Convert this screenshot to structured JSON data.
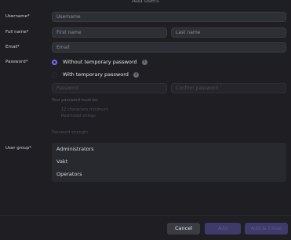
{
  "dialog": {
    "title": "Add users"
  },
  "form": {
    "username_label": "Username*",
    "username_placeholder": "Username",
    "fullname_label": "Full name*",
    "firstname_placeholder": "First name",
    "lastname_placeholder": "Last name",
    "email_label": "Email*",
    "email_placeholder": "Email",
    "password_label": "Password*",
    "option_without_temp": "Without temporary password",
    "option_with_temp": "With temporary password",
    "info_glyph": "i",
    "password_placeholder": "Password",
    "confirm_password_placeholder": "Confirm password",
    "password_rules_heading": "Your password must be:",
    "rule_min_chars": "12 characters minimum",
    "rule_restricted": "Restricted strings",
    "password_strength": "Password strength",
    "usergroup_label": "User group*",
    "usergroups": [
      "Administrators",
      "Vakt",
      "Operators"
    ]
  },
  "footer": {
    "cancel_label": "Cancel",
    "add_label": "Add",
    "add_close_label": "Add & Close"
  },
  "colors": {
    "accent": "#7b64ff",
    "background": "#1e1e23",
    "input_bg": "#2e2e35"
  }
}
